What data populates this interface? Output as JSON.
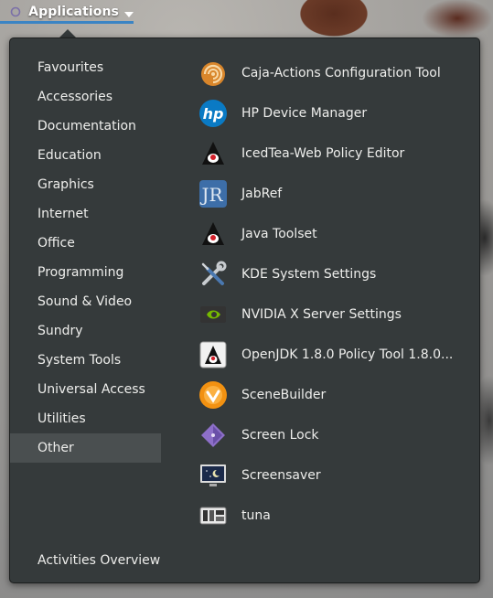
{
  "topbar": {
    "applications_label": "Applications"
  },
  "categories": [
    "Favourites",
    "Accessories",
    "Documentation",
    "Education",
    "Graphics",
    "Internet",
    "Office",
    "Programming",
    "Sound & Video",
    "Sundry",
    "System Tools",
    "Universal Access",
    "Utilities",
    "Other"
  ],
  "active_category": "Other",
  "activities_label": "Activities Overview",
  "apps": [
    {
      "name": "Caja-Actions Configuration Tool",
      "icon": "caja-actions-icon"
    },
    {
      "name": "HP Device Manager",
      "icon": "hp-icon"
    },
    {
      "name": "IcedTea-Web Policy Editor",
      "icon": "java-duke-icon"
    },
    {
      "name": "JabRef",
      "icon": "jabref-icon"
    },
    {
      "name": "Java Toolset",
      "icon": "java-duke-icon"
    },
    {
      "name": "KDE System Settings",
      "icon": "wrench-screwdriver-icon"
    },
    {
      "name": "NVIDIA X Server Settings",
      "icon": "nvidia-icon"
    },
    {
      "name": "OpenJDK 1.8.0 Policy Tool 1.8.0...",
      "icon": "openjdk-icon"
    },
    {
      "name": "SceneBuilder",
      "icon": "scenebuilder-icon"
    },
    {
      "name": "Screen Lock",
      "icon": "screen-lock-icon"
    },
    {
      "name": "Screensaver",
      "icon": "screensaver-icon"
    },
    {
      "name": "tuna",
      "icon": "tuna-icon"
    }
  ],
  "colors": {
    "menu_bg": "#353a3b",
    "active_bg": "#4a4f50",
    "accent": "#3b84c4",
    "text": "#eeeeec"
  }
}
